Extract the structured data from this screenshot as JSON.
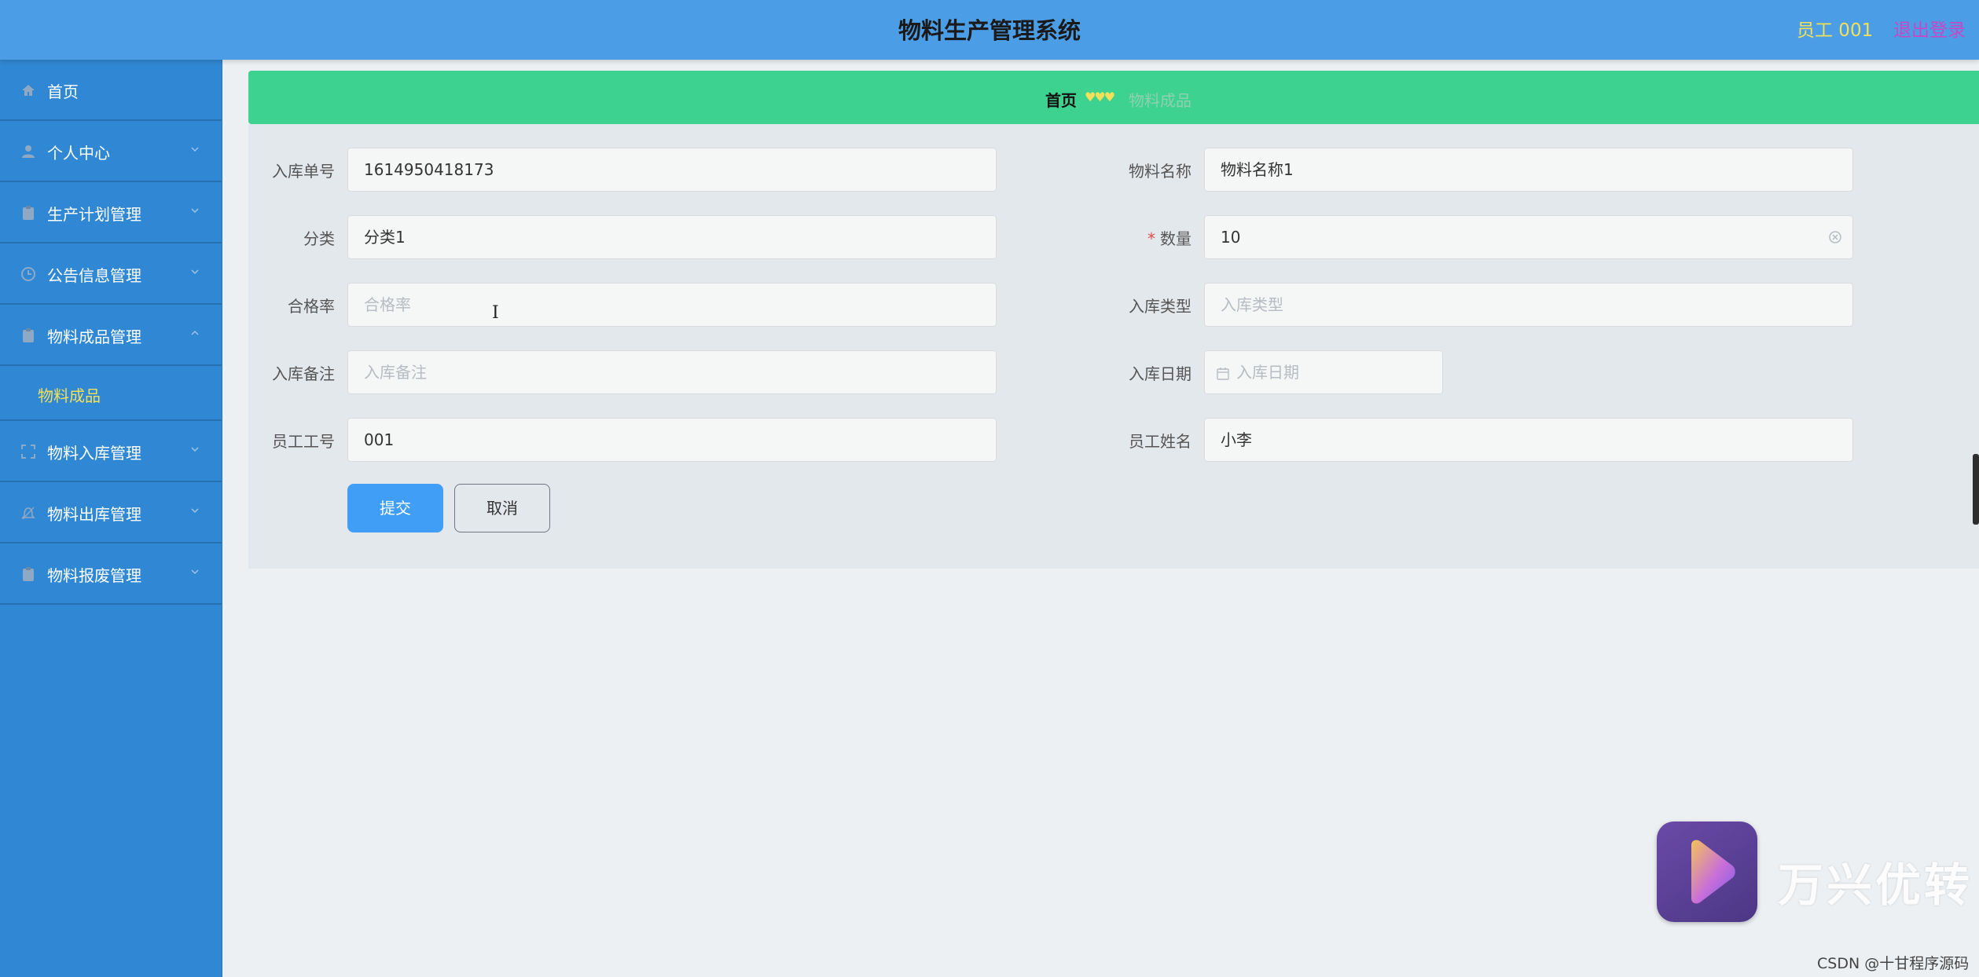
{
  "header": {
    "title": "物料生产管理系统",
    "user_label": "员工 001",
    "logout_label": "退出登录"
  },
  "sidebar": {
    "items": [
      {
        "label": "首页",
        "icon": "home-icon"
      },
      {
        "label": "个人中心",
        "icon": "user-icon"
      },
      {
        "label": "生产计划管理",
        "icon": "clipboard-icon"
      },
      {
        "label": "公告信息管理",
        "icon": "clock-icon"
      },
      {
        "label": "物料成品管理",
        "icon": "clipboard-icon",
        "expanded": true
      },
      {
        "label": "物料入库管理",
        "icon": "fullscreen-icon"
      },
      {
        "label": "物料出库管理",
        "icon": "bell-icon"
      },
      {
        "label": "物料报废管理",
        "icon": "clipboard-icon"
      }
    ],
    "subitems": [
      {
        "label": "物料成品"
      }
    ]
  },
  "breadcrumb": {
    "home": "首页",
    "separator": "♥♥♥",
    "current": "物料成品"
  },
  "form": {
    "fields": {
      "entry_no": {
        "label": "入库单号",
        "value": "1614950418173"
      },
      "material_name": {
        "label": "物料名称",
        "value": "物料名称1"
      },
      "category": {
        "label": "分类",
        "value": "分类1"
      },
      "quantity": {
        "label": "数量",
        "required_mark": "*",
        "value": "10"
      },
      "pass_rate": {
        "label": "合格率",
        "placeholder": "合格率"
      },
      "entry_type": {
        "label": "入库类型",
        "placeholder": "入库类型"
      },
      "entry_remark": {
        "label": "入库备注",
        "placeholder": "入库备注"
      },
      "entry_date": {
        "label": "入库日期",
        "placeholder": "入库日期"
      },
      "employee_no": {
        "label": "员工工号",
        "value": "001"
      },
      "employee_name": {
        "label": "员工姓名",
        "value": "小李"
      }
    },
    "submit_label": "提交",
    "cancel_label": "取消"
  },
  "watermark": {
    "brand_text": "万兴优转",
    "csdn_text": "CSDN @十甘程序源码"
  },
  "colors": {
    "header_bg": "#4b9de6",
    "sidebar_bg": "#3088d4",
    "breadcrumb_bg": "#3dd28f",
    "accent_yellow": "#f2e05a",
    "logout_pink": "#c648c7",
    "primary_button": "#409ef7"
  }
}
